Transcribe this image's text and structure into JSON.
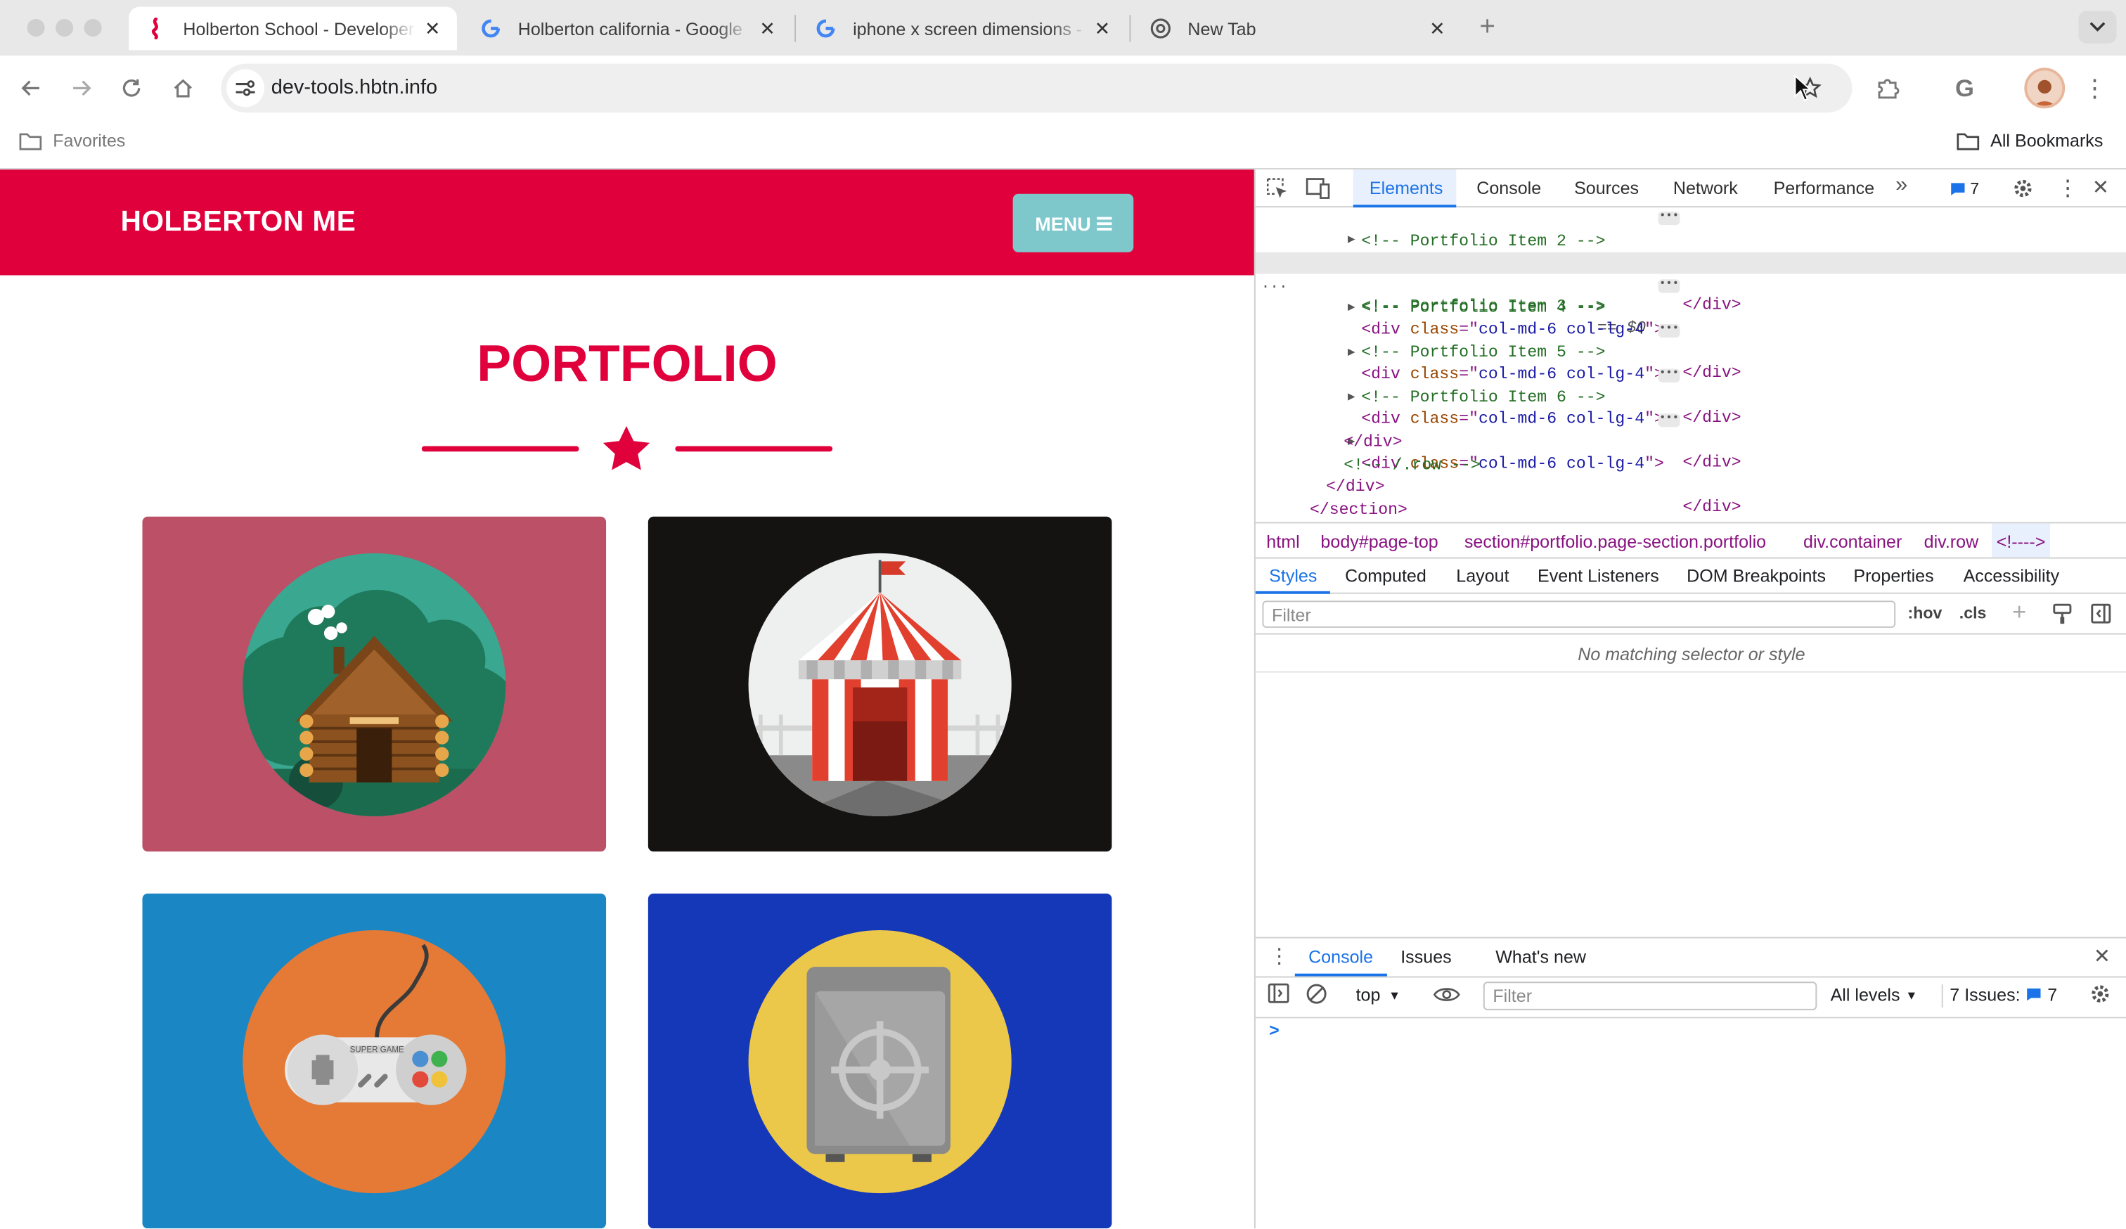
{
  "browser": {
    "tabs": [
      {
        "title": "Holberton School - Developer"
      },
      {
        "title": "Holberton california - Google"
      },
      {
        "title": "iphone x screen dimensions -"
      },
      {
        "title": "New Tab"
      }
    ],
    "url": "dev-tools.hbtn.info",
    "bookmarks": {
      "folder": "Favorites",
      "all": "All Bookmarks"
    }
  },
  "site": {
    "brand": "HOLBERTON ME",
    "menu": "MENU",
    "section_title": "PORTFOLIO",
    "tiles": [
      {
        "name": "cabin",
        "color": "#bb5066"
      },
      {
        "name": "circus-tent",
        "color": "#151212"
      },
      {
        "name": "game-controller",
        "color": "#1a86c4"
      },
      {
        "name": "safe",
        "color": "#1538b8"
      }
    ]
  },
  "devtools": {
    "tabs": [
      "Elements",
      "Console",
      "Sources",
      "Network",
      "Performance"
    ],
    "issues_badge": "7",
    "dom": {
      "div_attr": "class",
      "div_class": "col-md-6 col-lg-4",
      "item2": "<!-- Portfolio Item 2 -->",
      "item3": "<!-- Portfolio Item 3 -->",
      "sel_marker": "== $0",
      "item4": "<!-- Portfolio Item 4 -->",
      "item5": "<!-- Portfolio Item 5 -->",
      "item6": "<!-- Portfolio Item 6 -->",
      "close_div": "</div>",
      "row_cmt": "<!-- /.row -->",
      "close_section": "</section>"
    },
    "breadcrumbs": [
      "html",
      "body#page-top",
      "section#portfolio.page-section.portfolio",
      "div.container",
      "div.row",
      "<!---->"
    ],
    "style_tabs": [
      "Styles",
      "Computed",
      "Layout",
      "Event Listeners",
      "DOM Breakpoints",
      "Properties",
      "Accessibility"
    ],
    "filter_placeholder": "Filter",
    "hov": ":hov",
    "cls": ".cls",
    "no_match": "No matching selector or style",
    "drawer": {
      "tabs": [
        "Console",
        "Issues",
        "What's new"
      ],
      "context": "top",
      "filter_placeholder": "Filter",
      "levels": "All levels",
      "issues_label": "7 Issues:",
      "issues_count": "7",
      "prompt": ">"
    }
  },
  "colors": {
    "brand_red": "#e0003c",
    "menu_teal": "#7ec8cc",
    "devtools_blue": "#1a73e8"
  }
}
